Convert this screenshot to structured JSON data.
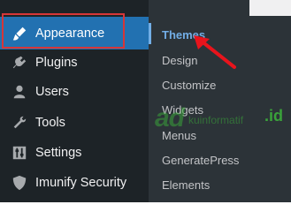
{
  "sidebar": {
    "items": [
      {
        "label": "Appearance",
        "icon": "paintbrush-icon",
        "active": true
      },
      {
        "label": "Plugins",
        "icon": "plugin-icon"
      },
      {
        "label": "Users",
        "icon": "user-icon"
      },
      {
        "label": "Tools",
        "icon": "wrench-icon"
      },
      {
        "label": "Settings",
        "icon": "settings-sliders-icon"
      },
      {
        "label": "Imunify Security",
        "icon": "shield-icon"
      }
    ]
  },
  "submenu": {
    "items": [
      {
        "label": "Themes",
        "current": true
      },
      {
        "label": "Design"
      },
      {
        "label": "Customize"
      },
      {
        "label": "Widgets"
      },
      {
        "label": "Menus"
      },
      {
        "label": "GeneratePress"
      },
      {
        "label": "Elements"
      }
    ]
  },
  "watermark": {
    "logo": "ad",
    "text": "kuinformatif",
    "suffix": ".id"
  },
  "colors": {
    "sidebar_bg": "#1d2327",
    "submenu_bg": "#2c3338",
    "active_bg": "#2271b1",
    "current_link": "#72aee6",
    "highlight": "#d63638",
    "watermark": "#3aa23a"
  }
}
